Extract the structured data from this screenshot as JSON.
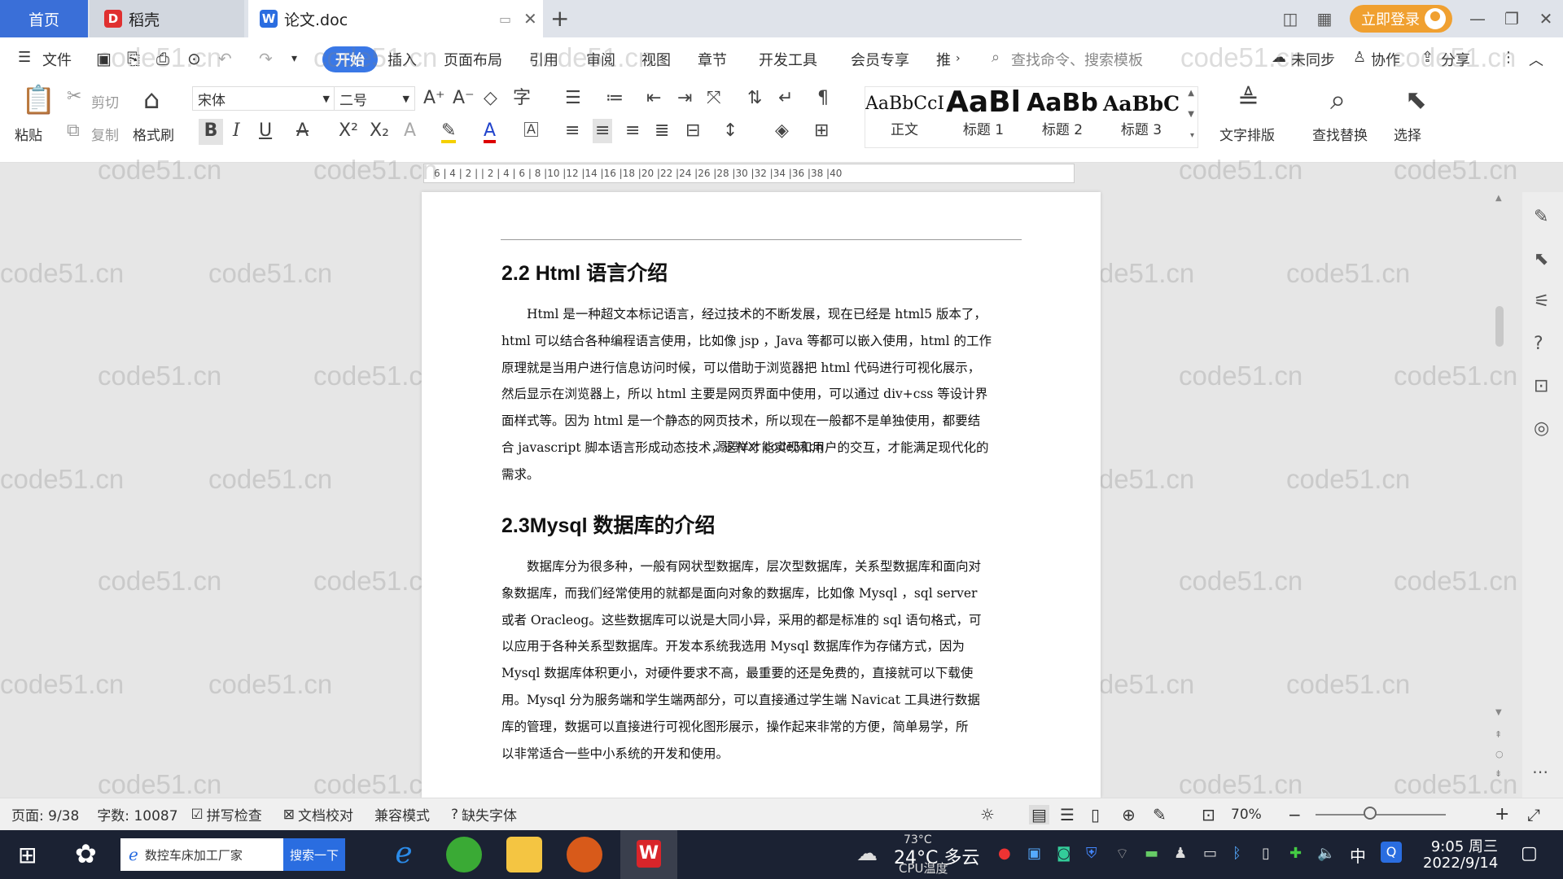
{
  "tabs": {
    "home": "首页",
    "daoke": "稻壳",
    "doc": "论文.doc"
  },
  "titlebar": {
    "login": "立即登录"
  },
  "menu": {
    "file": "文件",
    "items": [
      "开始",
      "插入",
      "页面布局",
      "引用",
      "审阅",
      "视图",
      "章节",
      "开发工具",
      "会员专享",
      "推"
    ],
    "search": "查找命令、搜索模板",
    "sync": "未同步",
    "collab": "协作",
    "share": "分享"
  },
  "ribbon": {
    "paste": "粘贴",
    "cut": "剪切",
    "copy": "复制",
    "format_painter": "格式刷",
    "font": "宋体",
    "size": "二号",
    "styles": [
      {
        "preview": "AaBbCcI",
        "label": "正文"
      },
      {
        "preview": "AaBl",
        "label": "标题 1"
      },
      {
        "preview": "AaBb",
        "label": "标题 2"
      },
      {
        "preview": "AaBbC",
        "label": "标题 3"
      }
    ],
    "text_layout": "文字排版",
    "find_replace": "查找替换",
    "select": "选择"
  },
  "ruler": "6 | 4 | 2 |   | 2 | 4 | 6 | 8 |10 |12 |14 |16 |18 |20 |22 |24 |26 |28 |30 |32 |34 |36 |38 |40",
  "doc": {
    "h1": "2.2 Html 语言介绍",
    "p1": [
      "Html 是一种超文本标记语言，经过技术的不断发展，现在已经是 html5 版本了，",
      "html 可以结合各种编程语言使用，比如像 jsp ，Java 等都可以嵌入使用，html 的工作",
      "原理就是当用户进行信息访问时候，可以借助于浏览器把 html 代码进行可视化展示，",
      "然后显示在浏览器上，所以 html 主要是网页界面中使用，可以通过 div+css 等设计界",
      "面样式等。因为 html 是一个静态的网页技术，所以现在一般都不是单独使用，都要结",
      "合 javascript 脚本语言形成动态技术，这样才能实现和用户的交互，才能满足现代化的",
      "需求。"
    ],
    "h2": "2.3Mysql 数据库的介绍",
    "p2": [
      "数据库分为很多种，一般有网状型数据库，层次型数据库，关系型数据库和面向对",
      "象数据库，而我们经常使用的就都是面向对象的数据库，比如像 Mysql ，sql server",
      "或者 Oracleog。这些数据库可以说是大同小异，采用的都是标准的 sql 语句格式，可",
      "以应用于各种关系型数据库。开发本系统我选用 Mysql 数据库作为存储方式，因为",
      "Mysql 数据库体积更小，对硬件要求不高，最重要的还是免费的，直接就可以下载使",
      "用。Mysql 分为服务端和学生端两部分，可以直接通过学生端 Navicat 工具进行数据",
      "库的管理，数据可以直接进行可视化图形展示，操作起来非常的方便，简单易学，所",
      "以非常适合一些中小系统的开发和使用。"
    ],
    "overlay": "源码VX: code51cn"
  },
  "watermark": "code51.cn",
  "status": {
    "page": "页面: 9/38",
    "words": "字数: 10087",
    "spell": "拼写检查",
    "proof": "文档校对",
    "compat": "兼容模式",
    "missing_font": "缺失字体",
    "zoom": "70%"
  },
  "taskbar": {
    "search_text": "数控车床加工厂家",
    "search_btn": "搜索一下",
    "weather": "24°C 多云",
    "cpu_temp": "73°C",
    "cpu_label": "CPU温度",
    "ime": "中",
    "time": "9:05 周三",
    "date": "2022/9/14"
  }
}
